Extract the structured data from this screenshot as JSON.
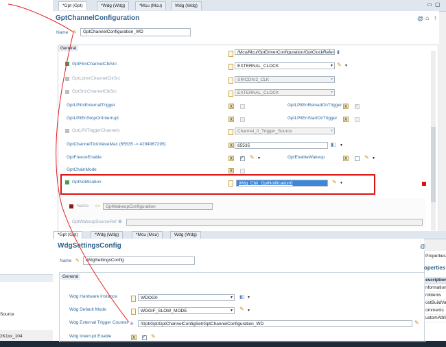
{
  "top_tabs": [
    "*Gpt (Gpt)",
    "*Wdg (Wdg)",
    "*Mcu (Mcu)",
    "Wdg (Wdg)"
  ],
  "gpt": {
    "title": "GptChannelConfiguration",
    "name_label": "Name",
    "name_value": "GptChannelConfiguration_WD",
    "tab": "General",
    "top_field_value": "/Mcu/Mcu/GptDriverConfiguration/GptClockReferencePoint_SIRC",
    "rows": {
      "ftm_label": "GptFtmChannelClkSrc",
      "ftm_value": "EXTERNAL_CLOCK",
      "lptmr_label": "GptLptmrChannelClkSrc",
      "lptmr_value": "SIRCDIV2_CLK",
      "srtc_label": "GptSrtcChannelClkSrc",
      "srtc_value": "EXTERNAL_CLOCK",
      "lpit_ext_label": "GptLPitIsExternalTrigger",
      "lpit_reload_label": "GptLPitEnReloadOnTrigger",
      "lpit_stop_label": "GptLPitEnStopOnInterrupt",
      "lpit_start_label": "GptLPitEnStartOnTrigger",
      "lpit_channels_label": "GptLPitTriggerChannels",
      "lpit_channels_value": "Channel_0_Trigger_Source",
      "tick_label": "GptChannelTickValueMax (65535 -> 4294967295)",
      "tick_value": "65535",
      "freeze_label": "GptFreezeEnable",
      "wakeup_label": "GptEnableWakeup",
      "chain_label": "GptChainMode",
      "notif_label": "GptNotification",
      "notif_value": "Wdg_Cbk_GptNotification0",
      "wakeupcfg_title": "GptWakeupConfiguration",
      "wakeupcfg_name_label": "Name",
      "wakeupcfg_name_value": "GptWakeupConfiguration",
      "wakeupref_label": "GptWakeupSourceRef"
    }
  },
  "wdg": {
    "title": "WdgSettingsConfig",
    "name_label": "Name",
    "name_value": "WdgSettingsConfig",
    "tab": "General",
    "rows": {
      "hw_label": "Wdg Hardware Instance",
      "hw_value": "WDOG0",
      "mode_label": "Wdg Default Mode",
      "mode_value": "WDGIF_SLOW_MODE",
      "ext_label": "Wdg External Trigger Counter",
      "ext_value": "/Gpt/Gpt/GptChannelConfigSet/GptChannelConfiguration_WD",
      "irq_label": "Wdg Interrupt Enable"
    }
  },
  "right_panel": {
    "header": "Properties",
    "title": "operties",
    "items": [
      "escription",
      "nformation",
      "roblems",
      "ostBuildVaria",
      "omments",
      "ustomAttrib"
    ]
  },
  "left_fragments": {
    "source": "Source",
    "status": "2K1xx_104"
  },
  "colors": {
    "accent": "#2e5f8a",
    "highlight": "#dd1111",
    "selection": "#3d86d8"
  }
}
